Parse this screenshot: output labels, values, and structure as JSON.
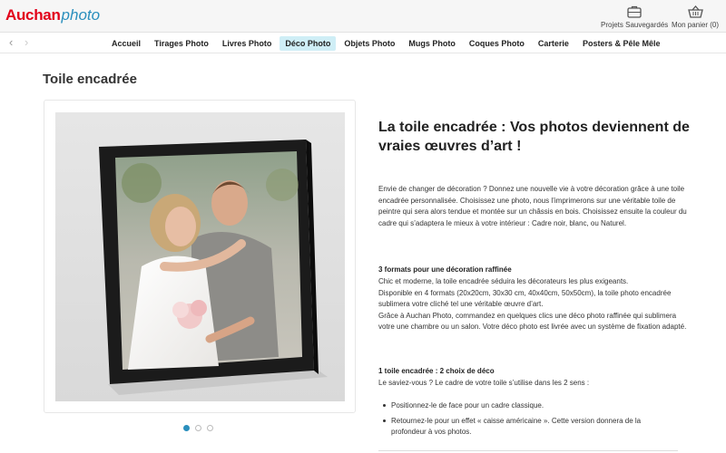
{
  "header": {
    "brand": "Auchan",
    "brand_suffix": "photo",
    "saved_projects": "Projets Sauvegardés",
    "cart": "Mon panier (0)",
    "colors": {
      "brand": "#e2001a",
      "accent": "#2a8fbd"
    }
  },
  "nav": {
    "back_icon": "chevron-left-icon",
    "forward_icon": "chevron-right-icon",
    "items": [
      {
        "label": "Accueil",
        "active": false
      },
      {
        "label": "Tirages Photo",
        "active": false
      },
      {
        "label": "Livres Photo",
        "active": false
      },
      {
        "label": "Déco Photo",
        "active": true
      },
      {
        "label": "Objets Photo",
        "active": false
      },
      {
        "label": "Mugs Photo",
        "active": false
      },
      {
        "label": "Coques Photo",
        "active": false
      },
      {
        "label": "Carterie",
        "active": false
      },
      {
        "label": "Posters & Pêle Mêle",
        "active": false
      }
    ]
  },
  "page": {
    "title": "Toile encadrée"
  },
  "gallery": {
    "dots": 3,
    "active_index": 0
  },
  "content": {
    "headline": "La toile encadrée : Vos photos deviennent de vraies œuvres d’art !",
    "intro": "Envie de changer de décoration ? Donnez une nouvelle vie à votre décoration grâce à une toile encadrée personnalisée. Choisissez une photo, nous l’imprimerons sur une véritable toile de peintre qui sera alors tendue et montée sur un châssis en bois. Choisissez ensuite la couleur du cadre qui s’adaptera le mieux à votre intérieur : Cadre noir, blanc, ou Naturel.",
    "section2_title": "3 formats pour une décoration raffinée",
    "section2_line1": "Chic et moderne, la toile encadrée séduira les décorateurs les plus exigeants.",
    "section2_line2": "Disponible en 4 formats (20x20cm, 30x30 cm, 40x40cm, 50x50cm), la toile photo encadrée sublimera votre cliché tel une véritable œuvre d’art.",
    "section2_line3": "Grâce à Auchan Photo, commandez en quelques clics une déco photo raffinée qui sublimera votre une chambre ou un salon. Votre déco photo est livrée avec un système de fixation adapté.",
    "section3_title": "1 toile encadrée : 2 choix de déco",
    "section3_intro": "Le saviez-vous ? Le cadre de votre toile s’utilise dans les 2 sens :",
    "bullets": [
      "Positionnez-le de face pour un cadre classique.",
      "Retournez-le pour un effet « caisse américaine ». Cette version donnera de la profondeur à vos photos."
    ]
  }
}
